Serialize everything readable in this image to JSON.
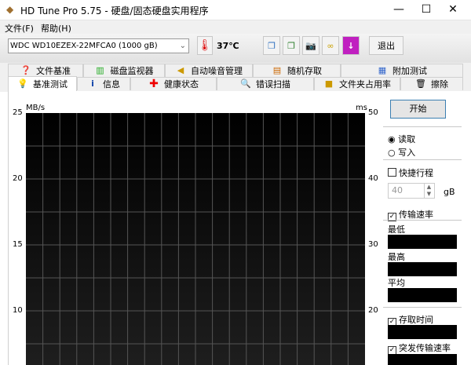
{
  "window": {
    "title": "HD Tune Pro 5.75 - 硬盘/固态硬盘实用程序",
    "min": "—",
    "max": "☐",
    "close": "✕"
  },
  "menu": [
    "文件(F)",
    "帮助(H)"
  ],
  "toolbar": {
    "drive": "WDC WD10EZEX-22MFCA0 (1000 gB)",
    "temperature": "37℃",
    "exit": "退出"
  },
  "tabs_top": [
    {
      "label": "文件基准",
      "icon": "file-benchmark-icon"
    },
    {
      "label": "磁盘监视器",
      "icon": "disk-monitor-icon"
    },
    {
      "label": "自动噪音管理",
      "icon": "speaker-icon"
    },
    {
      "label": "随机存取",
      "icon": "random-access-icon"
    },
    {
      "label": "附加测试",
      "icon": "extra-tests-icon"
    }
  ],
  "tabs_bottom": [
    {
      "label": "基准测试",
      "icon": "bulb-icon"
    },
    {
      "label": "信息",
      "icon": "info-icon"
    },
    {
      "label": "健康状态",
      "icon": "red-cross-icon"
    },
    {
      "label": "错误扫描",
      "icon": "magnifier-icon"
    },
    {
      "label": "文件夹占用率",
      "icon": "folder-icon"
    },
    {
      "label": "擦除",
      "icon": "trash-icon"
    }
  ],
  "active_tab": "基准测试",
  "chart_data": {
    "type": "line",
    "ylabel": "MB/s",
    "y2label": "ms",
    "ylim": [
      10,
      25
    ],
    "y2lim": [
      20,
      50
    ],
    "yticks": [
      "25",
      "20",
      "15",
      "10"
    ],
    "y2ticks": [
      "50",
      "40",
      "30",
      "20"
    ],
    "grid": true,
    "series": []
  },
  "side": {
    "start": "开始",
    "read": "读取",
    "write": "写入",
    "read_selected": true,
    "short_stroke": "快捷行程",
    "short_stroke_checked": false,
    "stroke_value": "40",
    "unit": "gB",
    "transfer_rate": "传输速率",
    "transfer_rate_checked": true,
    "min": "最低",
    "max": "最高",
    "avg": "平均",
    "access_time": "存取时间",
    "access_time_checked": true,
    "burst": "突发传输速率",
    "burst_checked": true
  }
}
